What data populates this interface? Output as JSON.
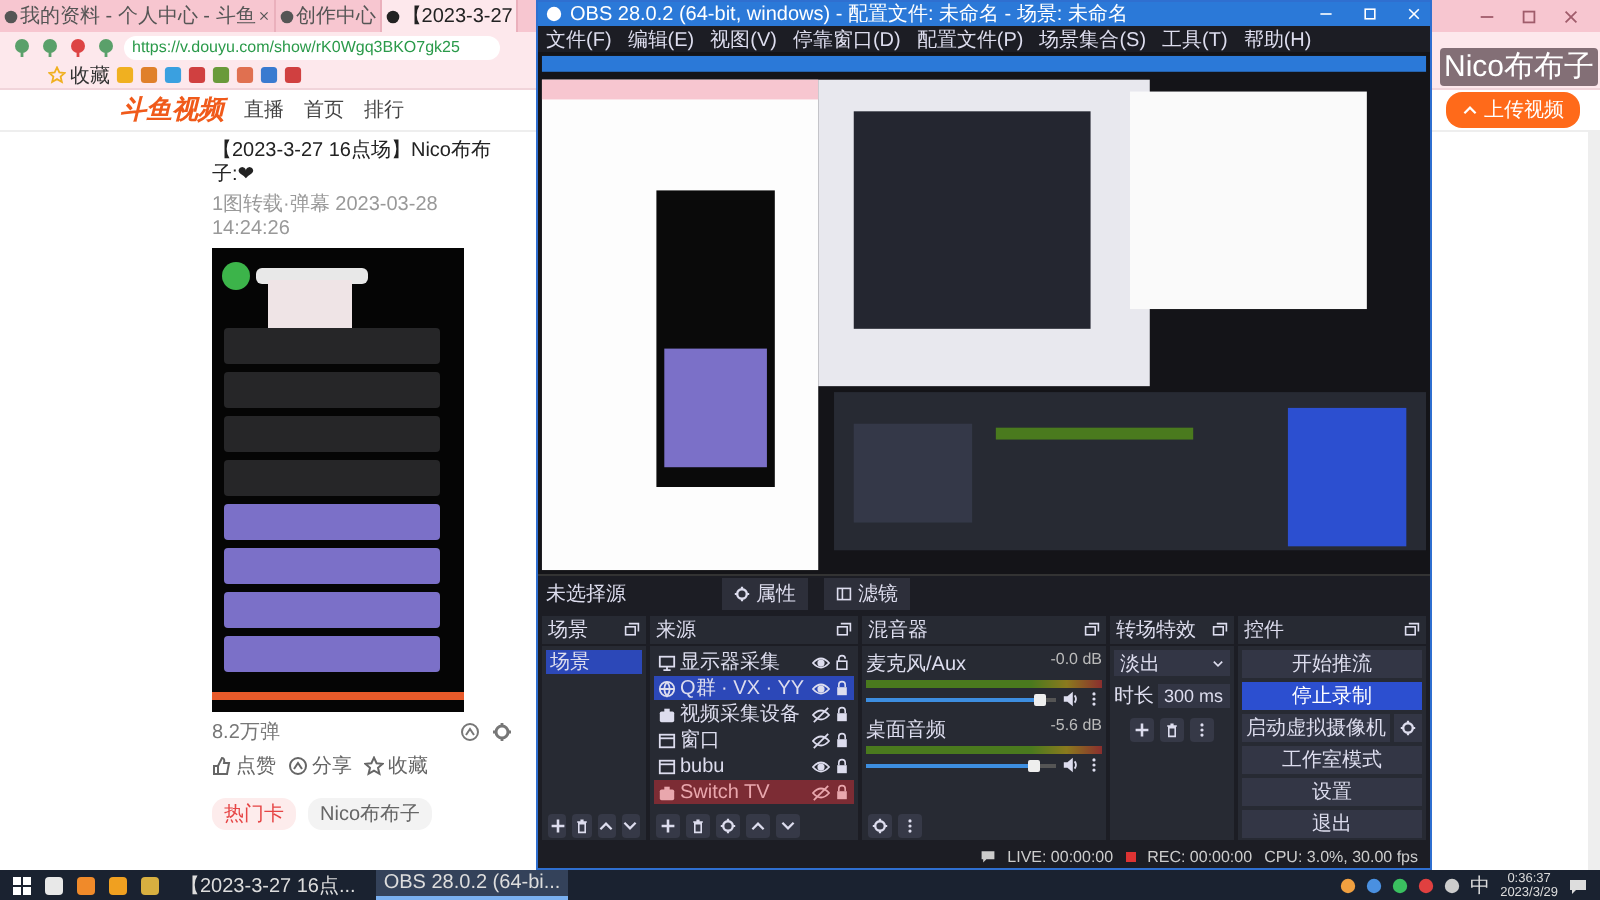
{
  "browser": {
    "tabs": [
      {
        "title": "我的资料 - 个人中心 - 斗鱼",
        "selected": false
      },
      {
        "title": "创作中心",
        "selected": false
      },
      {
        "title": "【2023-3-27",
        "selected": true
      }
    ],
    "url": "https://v.douyu.com/show/rK0Wgq3BKO7gk25",
    "bookmarks": [
      "收藏"
    ],
    "site": {
      "logo": "斗鱼视频",
      "nav": [
        {
          "label": "直播",
          "selected": false
        },
        {
          "label": "首页",
          "selected": false
        },
        {
          "label": "排行",
          "selected": false
        }
      ],
      "upload_button": "上传视频"
    },
    "video": {
      "title": "【2023-3-27 16点场】Nico布布子:❤",
      "meta": "1图转载·弹幕 2023-03-28 14:24:26",
      "danmaku_count": "8.2万弹",
      "actions": [
        "点赞",
        "分享",
        "收藏"
      ],
      "tags": [
        "热门卡",
        "Nico布布子"
      ]
    }
  },
  "overlay_text": "Nico布布子",
  "obs": {
    "title": "OBS 28.0.2 (64-bit, windows) - 配置文件: 未命名 - 场景: 未命名",
    "menu": [
      "文件(F)",
      "编辑(E)",
      "视图(V)",
      "停靠窗口(D)",
      "配置文件(P)",
      "场景集合(S)",
      "工具(T)",
      "帮助(H)"
    ],
    "no_source": "未选择源",
    "toolbar": [
      "属性",
      "滤镜"
    ],
    "scenes": {
      "title": "场景",
      "items": [
        {
          "name": "场景",
          "selected": true
        }
      ]
    },
    "sources": {
      "title": "来源",
      "items": [
        {
          "name": "显示器采集",
          "kind": "display",
          "selected": false,
          "visible": true,
          "locked": false,
          "error": false
        },
        {
          "name": "Q群 · VX · YY",
          "kind": "browser",
          "selected": true,
          "visible": true,
          "locked": true,
          "error": false
        },
        {
          "name": "视频采集设备",
          "kind": "camera",
          "selected": false,
          "visible": false,
          "locked": true,
          "error": false
        },
        {
          "name": "窗口",
          "kind": "window",
          "selected": false,
          "visible": false,
          "locked": true,
          "error": false
        },
        {
          "name": "bubu",
          "kind": "window",
          "selected": false,
          "visible": true,
          "locked": true,
          "error": false
        },
        {
          "name": "Switch TV",
          "kind": "camera",
          "selected": false,
          "visible": false,
          "locked": true,
          "error": true
        }
      ]
    },
    "mixer": {
      "title": "混音器",
      "channels": [
        {
          "name": "麦克风/Aux",
          "reading": "-0.0 dB",
          "level": 0.92
        },
        {
          "name": "桌面音频",
          "reading": "-5.6 dB",
          "level": 0.88
        }
      ]
    },
    "transitions": {
      "title": "转场特效",
      "type": "淡出",
      "duration_label": "时长",
      "duration": "300 ms"
    },
    "controls": {
      "title": "控件",
      "buttons": [
        {
          "label": "开始推流",
          "kind": "plain",
          "active": false
        },
        {
          "label": "停止录制",
          "kind": "plain",
          "active": true
        },
        {
          "label": "启动虚拟摄像机",
          "kind": "split",
          "active": false
        },
        {
          "label": "工作室模式",
          "kind": "plain",
          "active": false
        },
        {
          "label": "设置",
          "kind": "plain",
          "active": false
        },
        {
          "label": "退出",
          "kind": "plain",
          "active": false
        }
      ]
    },
    "status": {
      "live": "LIVE: 00:00:00",
      "rec": "REC: 00:00:00",
      "cpu": "CPU: 3.0%, 30.00 fps"
    }
  },
  "taskbar": {
    "apps": [
      {
        "label": "【2023-3-27 16点...",
        "selected": false
      },
      {
        "label": "OBS 28.0.2 (64-bi...",
        "selected": true
      }
    ],
    "ime": "中",
    "time": "0:36:37",
    "date": "2023/3/29"
  }
}
